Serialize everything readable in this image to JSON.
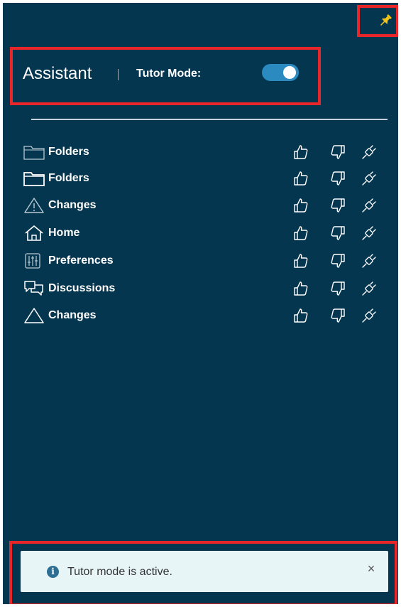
{
  "header": {
    "title": "Assistant",
    "tutor_mode_label": "Tutor Mode:",
    "tutor_mode_enabled": true
  },
  "pin": {
    "icon": "pin-icon",
    "color": "#f5c518"
  },
  "items": [
    {
      "label": "Folders",
      "icon": "folder-icon"
    },
    {
      "label": "Folders",
      "icon": "folder-icon"
    },
    {
      "label": "Changes",
      "icon": "warning-icon"
    },
    {
      "label": "Home",
      "icon": "home-icon"
    },
    {
      "label": "Preferences",
      "icon": "sliders-icon"
    },
    {
      "label": "Discussions",
      "icon": "discussions-icon"
    },
    {
      "label": "Changes",
      "icon": "triangle-icon"
    }
  ],
  "item_actions": [
    "thumbs-up-icon",
    "thumbs-down-icon",
    "plug-icon"
  ],
  "toast": {
    "message": "Tutor mode is active.",
    "close_label": "×",
    "info_label": "i"
  },
  "colors": {
    "panel_bg": "#04364f",
    "accent": "#2b8ac0",
    "highlight": "#e8262a",
    "toast_bg": "#e8f5f7"
  }
}
